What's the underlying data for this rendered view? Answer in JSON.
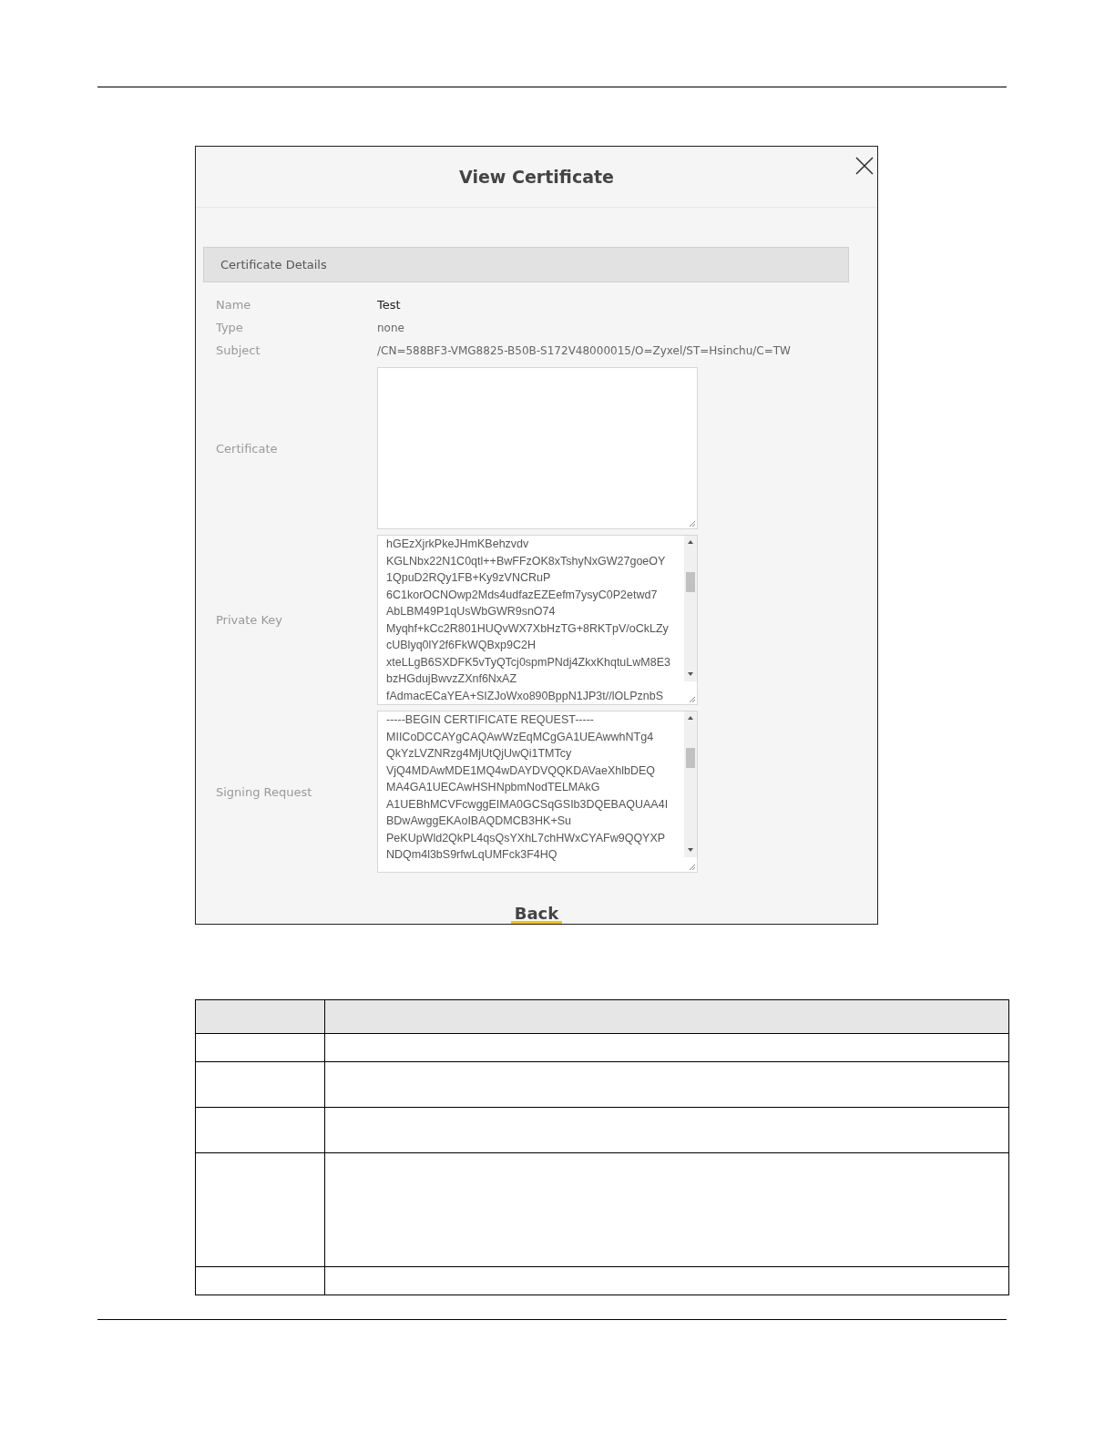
{
  "dialog": {
    "title": "View Certificate",
    "section": "Certificate Details",
    "fields": [
      {
        "kind": "text",
        "label": "Name",
        "value": "Test",
        "emphasis": true
      },
      {
        "kind": "text",
        "label": "Type",
        "value": "none",
        "emphasis": false
      },
      {
        "kind": "text",
        "label": "Subject",
        "value": "/CN=588BF3-VMG8825-B50B-S172V48000015/O=Zyxel/ST=Hsinchu/C=TW",
        "emphasis": false
      },
      {
        "kind": "textarea",
        "label": "Certificate",
        "scrollable": false
      },
      {
        "kind": "textarea",
        "label": "Private Key",
        "scrollable": true,
        "lines": [
          "hGEzXjrkPkeJHmKBehzvdv",
          "KGLNbx22N1C0qtl++BwFFzOK8xTshyNxGW27goeOY",
          "1QpuD2RQy1FB+Ky9zVNCRuP",
          "6C1korOCNOwp2Mds4udfazEZEefm7ysyC0P2etwd7",
          "AbLBM49P1qUsWbGWR9snO74",
          "Myqhf+kCc2R801HUQvWX7XbHzTG+8RKTpV/oCkLZy",
          "cUBlyq0lY2f6FkWQBxp9C2H",
          "xteLLgB6SXDFK5vTyQTcj0spmPNdj4ZkxKhqtuLwM8E3",
          "bzHGdujBwvzZXnf6NxAZ",
          "fAdmacECaYEA+SIZJoWxo890BppN1JP3t//lOLPznbS"
        ]
      },
      {
        "kind": "textarea",
        "label": "Signing Request",
        "scrollable": true,
        "lines": [
          "-----BEGIN CERTIFICATE REQUEST-----",
          "MIICoDCCAYgCAQAwWzEqMCgGA1UEAwwhNTg4",
          "QkYzLVZNRzg4MjUtQjUwQi1TMTcy",
          "VjQ4MDAwMDE1MQ4wDAYDVQQKDAVaeXhlbDEQ",
          "MA4GA1UECAwHSHNpbmNodTELMAkG",
          "A1UEBhMCVFcwggEIMA0GCSqGSIb3DQEBAQUAA4I",
          "BDwAwggEKAoIBAQDMCB3HK+Su",
          "PeKUpWld2QkPL4qsQsYXhL7chHWxCYAFw9QQYXP",
          "NDQm4l3bS9rfwLqUMFck3F4HQ"
        ]
      }
    ],
    "back": "Back"
  }
}
